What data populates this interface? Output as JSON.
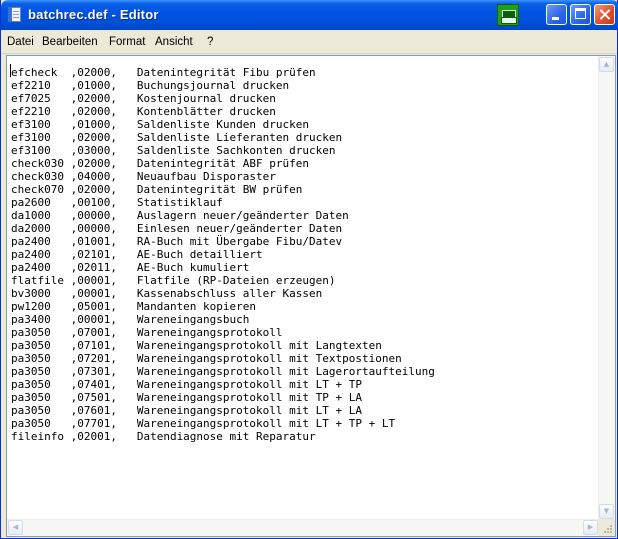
{
  "window": {
    "title": "batchrec.def - Editor",
    "icons": [
      "notepad-icon",
      "printer-tray-icon",
      "minimize-icon",
      "maximize-icon",
      "close-icon"
    ]
  },
  "menu": {
    "file": "Datei",
    "edit": "Bearbeiten",
    "format": "Format",
    "view": "Ansicht",
    "help": "?"
  },
  "document": {
    "lines": [
      "efcheck  ,02000,   Datenintegrität Fibu prüfen",
      "ef2210   ,01000,   Buchungsjournal drucken",
      "ef7025   ,02000,   Kostenjournal drucken",
      "ef2210   ,02000,   Kontenblätter drucken",
      "ef3100   ,01000,   Saldenliste Kunden drucken",
      "ef3100   ,02000,   Saldenliste Lieferanten drucken",
      "ef3100   ,03000,   Saldenliste Sachkonten drucken",
      "check030 ,02000,   Datenintegrität ABF prüfen",
      "check030 ,04000,   Neuaufbau Disporaster",
      "check070 ,02000,   Datenintegrität BW prüfen",
      "pa2600   ,00100,   Statistiklauf",
      "da1000   ,00000,   Auslagern neuer/geänderter Daten",
      "da2000   ,00000,   Einlesen neuer/geänderter Daten",
      "pa2400   ,01001,   RA-Buch mit Übergabe Fibu/Datev",
      "pa2400   ,02101,   AE-Buch detailliert",
      "pa2400   ,02011,   AE-Buch kumuliert",
      "flatfile ,00001,   Flatfile (RP-Dateien erzeugen)",
      "bv3000   ,00001,   Kassenabschluss aller Kassen",
      "pw1200   ,05001,   Mandanten kopieren",
      "pa3400   ,00001,   Wareneingangsbuch",
      "pa3050   ,07001,   Wareneingangsprotokoll",
      "pa3050   ,07101,   Wareneingangsprotokoll mit Langtexten",
      "pa3050   ,07201,   Wareneingangsprotokoll mit Textpostionen",
      "pa3050   ,07301,   Wareneingangsprotokoll mit Lagerortaufteilung",
      "pa3050   ,07401,   Wareneingangsprotokoll mit LT + TP",
      "pa3050   ,07501,   Wareneingangsprotokoll mit TP + LA",
      "pa3050   ,07601,   Wareneingangsprotokoll mit LT + LA",
      "pa3050   ,07701,   Wareneingangsprotokoll mit LT + TP + LT",
      "fileinfo ,02001,   Datendiagnose mit Reparatur"
    ]
  }
}
